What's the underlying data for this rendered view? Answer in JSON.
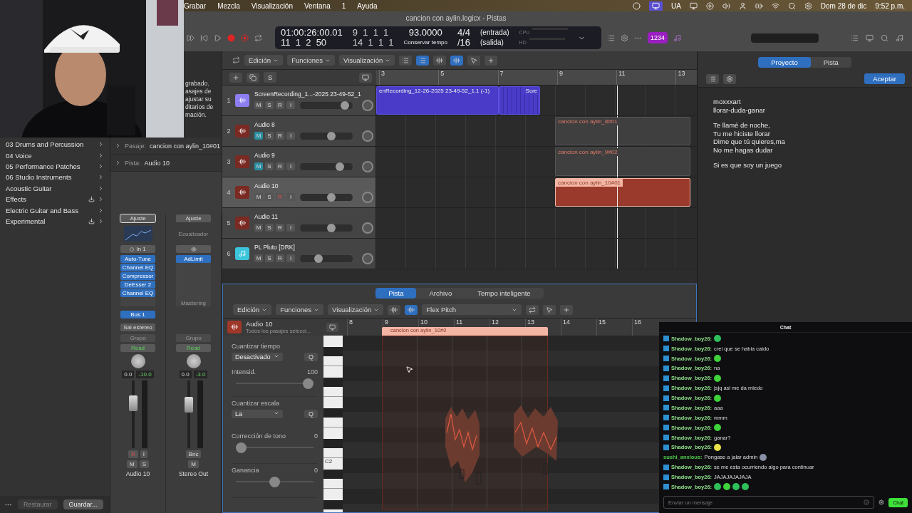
{
  "menu_bar": {
    "items": [
      "Grabar",
      "Mezcla",
      "Visualización",
      "Ventana",
      "1",
      "Ayuda"
    ],
    "input_source": "UA",
    "date": "Dom 28 de dic",
    "time": "9:52 p.m."
  },
  "window": {
    "title": "cancion con aylin.logicx - Pistas"
  },
  "control_bar": {
    "time": "01:00:26:00.01",
    "position": "11  1  2  50",
    "locator_left": "9  1  1  1",
    "locator_right": "14  1  1  1",
    "tempo": "93.0000",
    "tempo_mode": "Conservar tempo",
    "signature": "4/4",
    "division": "/16",
    "input": "(entrada)",
    "output": "(salida)",
    "meters": [
      "CPU",
      "HD"
    ],
    "count_in": "1234"
  },
  "library": {
    "items": [
      {
        "label": "03 Drums and Percussion",
        "download": false
      },
      {
        "label": "04 Voice",
        "download": false
      },
      {
        "label": "05 Performance Patches",
        "download": false
      },
      {
        "label": "06 Studio Instruments",
        "download": false
      },
      {
        "label": "Acoustic Guitar",
        "download": false
      },
      {
        "label": "Effects",
        "download": true
      },
      {
        "label": "Electric Guitar and Bass",
        "download": false
      },
      {
        "label": "Experimental",
        "download": true
      }
    ],
    "buttons": [
      {
        "label": "Restaurar",
        "disabled": true
      },
      {
        "label": "Guardar...",
        "disabled": false
      }
    ]
  },
  "inspector": {
    "help_lines": [
      "grabado.",
      "asajes de",
      "ajustar su",
      "ditarios de",
      "mación."
    ],
    "rows": [
      {
        "label": "Pasaje:",
        "value": "cancion con aylin_10#01"
      },
      {
        "label": "Pista:",
        "value": "Audio 10"
      }
    ],
    "strips": [
      {
        "setting": "Ajuste",
        "setting_selected": true,
        "input": "In 1",
        "inserts": [
          "Auto-Tune",
          "Channel EQ",
          "Compressor",
          "DeEsser 2",
          "Channel EQ"
        ],
        "send": "Bus 1",
        "output": "Sal estéreo",
        "group": "Grupo",
        "automation": "Read",
        "pan": "0.0",
        "volume": "-10.0",
        "level": 0.72,
        "buttons": [
          {
            "label": "R",
            "on": true
          },
          {
            "label": "I",
            "on": false
          }
        ],
        "mute_solo": [
          "M",
          "S"
        ],
        "name": "Audio 10"
      },
      {
        "setting": "Ajuste",
        "setting_selected": false,
        "eq_label": "Ecualizador",
        "inserts": [
          "AdLimit"
        ],
        "insert_note": "Mastering",
        "group": "Grupo",
        "automation": "Read",
        "pan": "0.0",
        "volume": "-3.0",
        "level": 0.7,
        "buttons": [
          {
            "label": "Bnc",
            "on": false
          }
        ],
        "mute_solo": [
          "M"
        ],
        "name": "Stereo Out"
      }
    ]
  },
  "main_toolbar": {
    "menus": [
      "Edición",
      "Funciones",
      "Visualización"
    ]
  },
  "track_header_buttons": [
    "S"
  ],
  "ruler": [
    "3",
    "5",
    "7",
    "9",
    "11",
    "13"
  ],
  "tracks": [
    {
      "number": "1",
      "name": "ScreenRecording_1...-2025 23-49-52_1",
      "kind": "audio",
      "color": "#8c7ef0",
      "buttons": [
        "M",
        "S",
        "R",
        "I"
      ],
      "muted": false,
      "record": false,
      "selected": false,
      "level": 0.92,
      "regions": [
        {
          "kind": "long",
          "label": "enRecording_12-26-2025 23-49-52_1.1 (-1)",
          "selected": false
        },
        {
          "kind": "short",
          "label": "Scre",
          "selected": false
        }
      ]
    },
    {
      "number": "2",
      "name": "Audio 8",
      "kind": "audio",
      "color": "#7a2a22",
      "buttons": [
        "M",
        "S",
        "R",
        "I"
      ],
      "muted": true,
      "record": false,
      "selected": false,
      "level": 0.62,
      "regions": [
        {
          "kind": "take",
          "label": "cancion con aylin_8#01",
          "selected": false
        }
      ]
    },
    {
      "number": "3",
      "name": "Audio 9",
      "kind": "audio",
      "color": "#7a2a22",
      "buttons": [
        "M",
        "S",
        "R",
        "I"
      ],
      "muted": true,
      "record": false,
      "selected": false,
      "level": 0.8,
      "regions": [
        {
          "kind": "take",
          "label": "cancion con aylin_9#02",
          "selected": false
        }
      ]
    },
    {
      "number": "4",
      "name": "Audio 10",
      "kind": "audio",
      "color": "#7a2a22",
      "buttons": [
        "M",
        "S",
        "R",
        "I"
      ],
      "muted": false,
      "record": true,
      "selected": true,
      "level": 0.62,
      "regions": [
        {
          "kind": "take",
          "label": "cancion con aylin_10#01",
          "selected": true
        }
      ]
    },
    {
      "number": "5",
      "name": "Audio 11",
      "kind": "audio",
      "color": "#7a2a22",
      "buttons": [
        "M",
        "S",
        "R",
        "I"
      ],
      "muted": false,
      "record": false,
      "selected": false,
      "level": 0.62
    },
    {
      "number": "6",
      "name": "PL Pluto [DRK]",
      "kind": "instrument",
      "color": "#3cc6dc",
      "buttons": [
        "M",
        "S",
        "R",
        "I"
      ],
      "muted": false,
      "record": false,
      "selected": false,
      "level": 0.32
    }
  ],
  "editor": {
    "tabs": [
      {
        "label": "Pista",
        "selected": true
      },
      {
        "label": "Archivo",
        "selected": false
      },
      {
        "label": "Tempo inteligente",
        "selected": false
      }
    ],
    "menus": [
      "Edición",
      "Funciones",
      "Visualización"
    ],
    "mode": "Flex Pitch",
    "track_name": "Audio 10",
    "track_note": "Todos los pasajes selecci...",
    "params": [
      {
        "kind": "select",
        "title": "Cuantizar tiempo",
        "value": "Desactivado",
        "button": "Q"
      },
      {
        "kind": "slider",
        "title": "Intensid.",
        "value": "100",
        "level": 1
      },
      {
        "kind": "select",
        "title": "Cuantizar escala",
        "value": "La",
        "button": "Q"
      },
      {
        "kind": "slider",
        "title": "Corrección de tono",
        "value": "0",
        "level": 0
      },
      {
        "kind": "slider",
        "title": "Ganancia",
        "value": "0",
        "level": 0.5
      }
    ],
    "ruler": [
      "8",
      "9",
      "10",
      "11",
      "12",
      "13",
      "14",
      "15",
      "16"
    ],
    "region_label": "cancion con aylin_10#0",
    "key_label": "C2"
  },
  "lyrics": {
    "tabs": [
      {
        "label": "Proyecto",
        "selected": true
      },
      {
        "label": "Pista",
        "selected": false
      }
    ],
    "accept": "Aceptar",
    "stanzas": [
      [
        "moxxxart",
        "llorar-duda-ganar"
      ],
      [
        "Te llamé de noche,",
        "Tu me hiciste llorar",
        "Dime que tú quieres,ma",
        "No me hagas dudar"
      ],
      [
        "Si es que soy un juego"
      ]
    ]
  },
  "chat": {
    "title": "Chat",
    "placeholder": "Enviar un mensaje",
    "send": "Chat",
    "messages": [
      {
        "user": "Shadow_boy26:",
        "color": "#8fe08a",
        "badge": true,
        "emotes": [
          {
            "color": "#2fbf5a"
          }
        ]
      },
      {
        "user": "Shadow_boy26:",
        "color": "#8fe08a",
        "badge": true,
        "text": "crei que se habia caido"
      },
      {
        "user": "Shadow_boy26:",
        "color": "#8fe08a",
        "badge": true,
        "emotes": [
          {
            "color": "#3fd23a"
          }
        ]
      },
      {
        "user": "Shadow_boy26:",
        "color": "#8fe08a",
        "badge": true,
        "text": "na"
      },
      {
        "user": "Shadow_boy26:",
        "color": "#8fe08a",
        "badge": true,
        "emotes": [
          {
            "color": "#3fd23a"
          }
        ]
      },
      {
        "user": "Shadow_boy26:",
        "color": "#8fe08a",
        "badge": true,
        "text": "jsjq asi me da miedo"
      },
      {
        "user": "Shadow_boy26:",
        "color": "#8fe08a",
        "badge": true,
        "emotes": [
          {
            "color": "#3fd23a"
          }
        ]
      },
      {
        "user": "Shadow_boy26:",
        "color": "#8fe08a",
        "badge": true,
        "text": "aaa"
      },
      {
        "user": "Shadow_boy26:",
        "color": "#8fe08a",
        "badge": true,
        "text": "mmm"
      },
      {
        "user": "Shadow_boy26:",
        "color": "#8fe08a",
        "badge": true,
        "emotes": [
          {
            "color": "#3fd23a"
          }
        ]
      },
      {
        "user": "Shadow_boy26:",
        "color": "#8fe08a",
        "badge": true,
        "text": "ganar?"
      },
      {
        "user": "Shadow_boy26:",
        "color": "#8fe08a",
        "badge": true,
        "emotes": [
          {
            "color": "#e8e24a"
          }
        ]
      },
      {
        "user": "sushi_anxious:",
        "color": "#4fc94a",
        "badge": false,
        "text": "Pongase a jalar admin",
        "emotes": [
          {
            "color": "#8a8fa8"
          }
        ]
      },
      {
        "user": "Shadow_boy26:",
        "color": "#8fe08a",
        "badge": true,
        "text": "se me esta ocurriendo algo para continuar"
      },
      {
        "user": "Shadow_boy26:",
        "color": "#8fe08a",
        "badge": true,
        "text": "JAJAJAJAJAJA"
      },
      {
        "user": "Shadow_boy26:",
        "color": "#8fe08a",
        "badge": true,
        "emotes": [
          {
            "color": "#2fbf5a"
          },
          {
            "color": "#3fd23a"
          },
          {
            "color": "#2fbf5a"
          },
          {
            "color": "#2fbf5a"
          }
        ]
      }
    ]
  }
}
